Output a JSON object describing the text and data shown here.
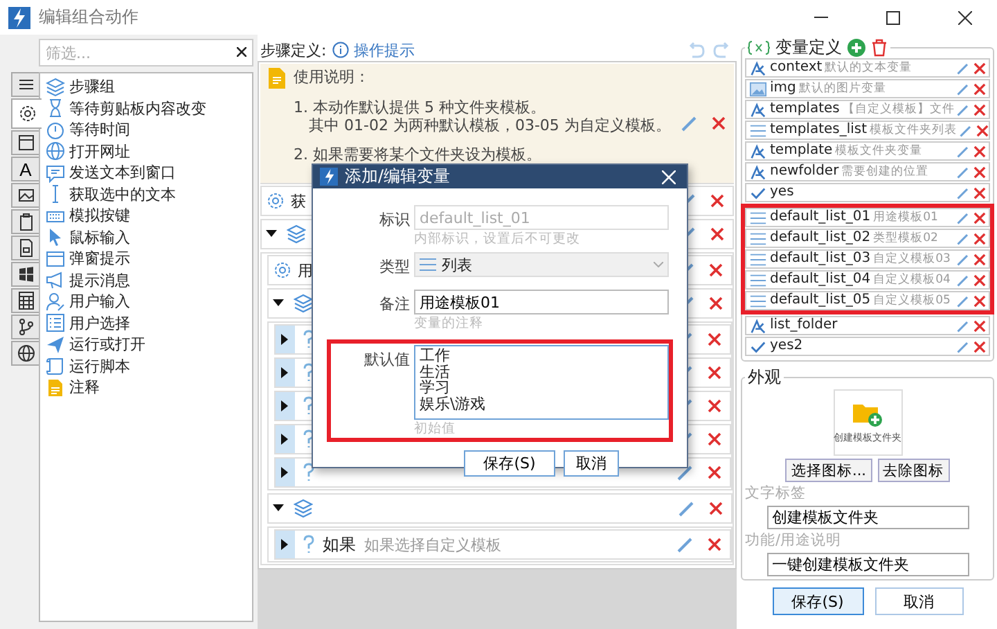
{
  "window": {
    "title": "编辑组合动作"
  },
  "filter": {
    "placeholder": "筛选..."
  },
  "category_tabs": [
    {
      "selected": false
    },
    {
      "selected": true
    },
    {
      "selected": false
    },
    {
      "selected": false,
      "label": "A"
    },
    {
      "selected": false
    },
    {
      "selected": false
    },
    {
      "selected": false
    },
    {
      "selected": false
    },
    {
      "selected": false
    },
    {
      "selected": false
    },
    {
      "selected": false
    }
  ],
  "actions": [
    {
      "label": "步骤组"
    },
    {
      "label": "等待剪贴板内容改变"
    },
    {
      "label": "等待时间"
    },
    {
      "label": "打开网址"
    },
    {
      "label": "发送文本到窗口"
    },
    {
      "label": "获取选中的文本"
    },
    {
      "label": "模拟按键"
    },
    {
      "label": "鼠标输入"
    },
    {
      "label": "弹窗提示"
    },
    {
      "label": "提示消息"
    },
    {
      "label": "用户输入"
    },
    {
      "label": "用户选择"
    },
    {
      "label": "运行或打开"
    },
    {
      "label": "运行脚本"
    },
    {
      "label": "注释"
    }
  ],
  "steps_header": {
    "label": "步骤定义:",
    "help_link": "操作提示"
  },
  "steps": [
    {
      "kind": "note",
      "title": "使用说明：",
      "lines": [
        "1. 本动作默认提供 5 种文件夹模板。",
        "其中 01-02 为两种默认模板，03-05 为自定义模板。",
        "2. 如果需要将某个文件夹设为模板。"
      ]
    },
    {
      "kind": "action",
      "label": "获"
    },
    {
      "kind": "group",
      "expanded": true,
      "children": [
        {
          "kind": "action",
          "label": "用"
        },
        {
          "kind": "group",
          "expanded": true,
          "children": [
            {
              "kind": "branch",
              "expanded": false
            },
            {
              "kind": "branch",
              "expanded": false
            },
            {
              "kind": "branch",
              "expanded": false
            },
            {
              "kind": "branch",
              "expanded": false
            },
            {
              "kind": "branch",
              "expanded": false
            }
          ]
        },
        {
          "kind": "group",
          "expanded": true,
          "children": [
            {
              "kind": "branch",
              "expanded": false,
              "label": "如果",
              "note": "如果选择自定义模板"
            }
          ]
        }
      ]
    }
  ],
  "dialog": {
    "title": "添加/编辑变量",
    "fields": [
      {
        "kind": "input",
        "label": "标识",
        "value": "default_list_01",
        "disabled": true,
        "hint": "内部标识，设置后不可更改"
      },
      {
        "kind": "select",
        "label": "类型",
        "value": "列表",
        "disabled": true
      },
      {
        "kind": "input",
        "label": "备注",
        "value": "用途模板01",
        "disabled": false,
        "hint": "变量的注释"
      },
      {
        "kind": "textarea",
        "label": "默认值",
        "lines": [
          "工作",
          "生活",
          "学习",
          "娱乐\\游戏"
        ],
        "hint": "初始值",
        "highlighted": true
      }
    ],
    "buttons": [
      "保存(S)",
      "取消"
    ]
  },
  "variables_panel": {
    "title": "变量定义"
  },
  "variables": [
    {
      "kind": "text",
      "name": "context",
      "note": "默认的文本变量",
      "highlighted": false
    },
    {
      "kind": "image",
      "name": "img",
      "note": "默认的图片变量",
      "highlighted": false
    },
    {
      "kind": "text",
      "name": "templates",
      "note": "【自定义模板】文件",
      "highlighted": false
    },
    {
      "kind": "list",
      "name": "templates_list",
      "note": "模板文件夹列表",
      "highlighted": false
    },
    {
      "kind": "text",
      "name": "template",
      "note": "模板文件夹变量",
      "highlighted": false
    },
    {
      "kind": "text",
      "name": "newfolder",
      "note": "需要创建的位置",
      "highlighted": false
    },
    {
      "kind": "bool",
      "name": "yes",
      "highlighted": false
    },
    {
      "kind": "list",
      "name": "default_list_01",
      "note": "用途模板01",
      "highlighted": true
    },
    {
      "kind": "list",
      "name": "default_list_02",
      "note": "类型模板02",
      "highlighted": true
    },
    {
      "kind": "list",
      "name": "default_list_03",
      "note": "自定义模板03",
      "highlighted": true
    },
    {
      "kind": "list",
      "name": "default_list_04",
      "note": "自定义模板04",
      "highlighted": true
    },
    {
      "kind": "list",
      "name": "default_list_05",
      "note": "自定义模板05",
      "highlighted": true
    },
    {
      "kind": "text",
      "name": "list_folder",
      "highlighted": false
    },
    {
      "kind": "bool",
      "name": "yes2",
      "highlighted": false
    }
  ],
  "appearance": {
    "title": "外观",
    "icon_caption": "创建模板文件夹",
    "buttons": [
      "选择图标...",
      "去除图标"
    ],
    "fields": [
      {
        "label": "文字标签",
        "value": "创建模板文件夹"
      },
      {
        "label": "功能/用途说明",
        "value": "一键创建模板文件夹"
      }
    ]
  },
  "buttons": [
    {
      "label": "保存(S)",
      "primary": true
    },
    {
      "label": "取消",
      "primary": false
    }
  ]
}
